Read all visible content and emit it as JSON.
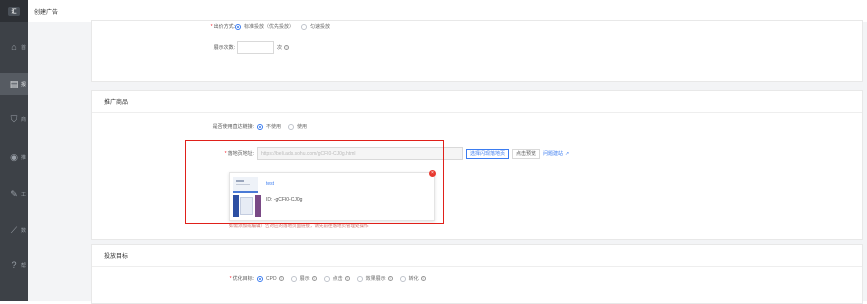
{
  "app": {
    "logo": "汇",
    "page_title": "创建广告"
  },
  "sidebar": {
    "items": [
      {
        "icon": "home-icon",
        "label": "首"
      },
      {
        "icon": "report-icon",
        "label": "报"
      },
      {
        "icon": "cart-icon",
        "label": "商"
      },
      {
        "icon": "target-icon",
        "label": "推"
      },
      {
        "icon": "tool-icon",
        "label": "工"
      },
      {
        "icon": "chart-icon",
        "label": "数"
      },
      {
        "icon": "help-icon",
        "label": "帮"
      }
    ]
  },
  "billing": {
    "method_label": "出价方式:",
    "options": [
      "标准投放（优先投放）",
      "匀速投放"
    ],
    "display_count_label": "展示次数:",
    "display_count_unit": "次"
  },
  "promo": {
    "section_title": "推广商品",
    "use_link_label": "是否使用直达链接:",
    "use_link_options": [
      "不使用",
      "使用"
    ],
    "landing_label": "落地页地址:",
    "landing_placeholder": "https://beli.ads.sohu.com/gCFI0-CJ0g.html",
    "select_button": "选择闪现落地页",
    "preview_button": "点击预览",
    "recreate_link": "问题建站",
    "product_name": "test",
    "product_id": "ID: -gCFI0-CJ0g",
    "hint_text": "如需添加或编辑广告对应的落地页面链接，请先前往落地页管理处操作"
  },
  "target": {
    "section_title": "投放目标",
    "goal_label": "优化目标:",
    "options": [
      "CPD",
      "展示",
      "点击",
      "效果展示",
      "转化"
    ]
  }
}
